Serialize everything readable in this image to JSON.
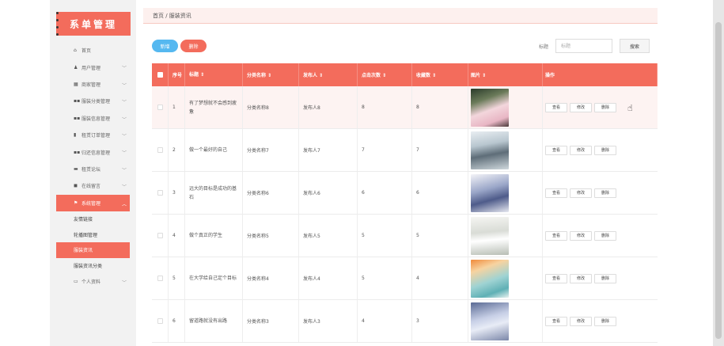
{
  "sidebar": {
    "brand": "系单管理",
    "menu": [
      {
        "label": "首页",
        "icon": "home-icon",
        "glyph": "⌂",
        "chevron": false
      },
      {
        "label": "用户管理",
        "icon": "user-icon",
        "glyph": "♟",
        "chevron": true
      },
      {
        "label": "商家管理",
        "icon": "shop-icon",
        "glyph": "▦",
        "chevron": true
      },
      {
        "label": "服装分类管理",
        "icon": "grid-icon",
        "glyph": "▪▪",
        "chevron": true
      },
      {
        "label": "服装信息管理",
        "icon": "grid-icon",
        "glyph": "▪▪",
        "chevron": true
      },
      {
        "label": "租赁订单管理",
        "icon": "bar-chart-icon",
        "glyph": "▮",
        "chevron": true
      },
      {
        "label": "归还信息管理",
        "icon": "grid-icon",
        "glyph": "▪▪",
        "chevron": true
      },
      {
        "label": "租赁论坛",
        "icon": "forum-icon",
        "glyph": "▬",
        "chevron": true
      },
      {
        "label": "在线留言",
        "icon": "message-icon",
        "glyph": "◼",
        "chevron": true
      },
      {
        "label": "系统管理",
        "icon": "flag-icon",
        "glyph": "⚑",
        "chevron": true,
        "active": true
      }
    ],
    "submenu": [
      {
        "label": "友情链接",
        "active": false
      },
      {
        "label": "轮播图管理",
        "active": false
      },
      {
        "label": "服装资讯",
        "active": true
      },
      {
        "label": "服装资讯分类",
        "active": false
      }
    ],
    "personal": {
      "label": "个人资料",
      "icon": "profile-icon",
      "glyph": "▭"
    }
  },
  "breadcrumb": "首页 / 服装资讯",
  "toolbar": {
    "add_label": "新增",
    "delete_label": "删除",
    "search_label": "标题",
    "search_placeholder": "标题",
    "search_button": "搜索"
  },
  "table": {
    "headers": {
      "index": "序号",
      "title": "标题 ⇕",
      "category": "分类名称 ⇕",
      "publisher": "发布人 ⇕",
      "clicks": "点击次数 ⇕",
      "favorites": "收藏数 ⇕",
      "image": "图片 ⇕",
      "actions": "操作"
    },
    "action_labels": {
      "view": "查看",
      "edit": "修改",
      "delete": "删除"
    },
    "rows": [
      {
        "index": "1",
        "title": "有了梦想就不会感到疲惫",
        "category": "分类名称8",
        "publisher": "发布人8",
        "clicks": "8",
        "favorites": "8"
      },
      {
        "index": "2",
        "title": "做一个最好的自己",
        "category": "分类名称7",
        "publisher": "发布人7",
        "clicks": "7",
        "favorites": "7"
      },
      {
        "index": "3",
        "title": "远大的目标是成功的基石",
        "category": "分类名称6",
        "publisher": "发布人6",
        "clicks": "6",
        "favorites": "6"
      },
      {
        "index": "4",
        "title": "做个真正的学生",
        "category": "分类名称5",
        "publisher": "发布人5",
        "clicks": "5",
        "favorites": "5"
      },
      {
        "index": "5",
        "title": "在大学给自己定个目标",
        "category": "分类名称4",
        "publisher": "发布人4",
        "clicks": "5",
        "favorites": "4"
      },
      {
        "index": "6",
        "title": "留道路就没有出路",
        "category": "分类名称3",
        "publisher": "发布人3",
        "clicks": "4",
        "favorites": "3"
      }
    ]
  },
  "colors": {
    "accent": "#f36c5c",
    "add_button": "#55b8f0",
    "breadcrumb_bg": "#fdf0ee"
  }
}
